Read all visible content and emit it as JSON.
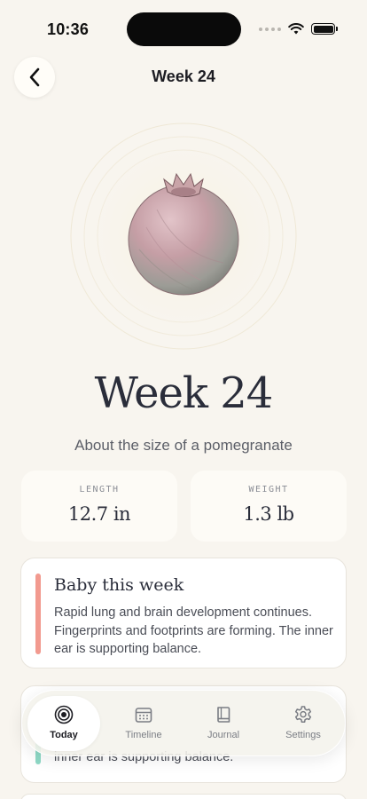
{
  "status_bar": {
    "time": "10:36"
  },
  "header": {
    "title": "Week 24",
    "back_icon": "chevron-left-icon"
  },
  "hero": {
    "illustration": "pomegranate-icon"
  },
  "week": {
    "heading": "Week 24",
    "size_comparison": "About the size of a pomegranate"
  },
  "stats": {
    "length": {
      "label": "LENGTH",
      "value": "12.7 in"
    },
    "weight": {
      "label": "WEIGHT",
      "value": "1.3 lb"
    }
  },
  "cards": [
    {
      "title": "Baby this week",
      "text": "Rapid lung and brain development continues. Fingerprints and footprints are forming. The inner ear is supporting balance.",
      "accent_color": "#f29a8f"
    },
    {
      "visible_text": "inner ear is supporting balance.",
      "accent_color": "#8ed9c6"
    }
  ],
  "tab_bar": {
    "tabs": [
      {
        "label": "Today",
        "icon": "target-icon",
        "active": true
      },
      {
        "label": "Timeline",
        "icon": "calendar-icon",
        "active": false
      },
      {
        "label": "Journal",
        "icon": "book-icon",
        "active": false
      },
      {
        "label": "Settings",
        "icon": "gear-icon",
        "active": false
      }
    ]
  }
}
